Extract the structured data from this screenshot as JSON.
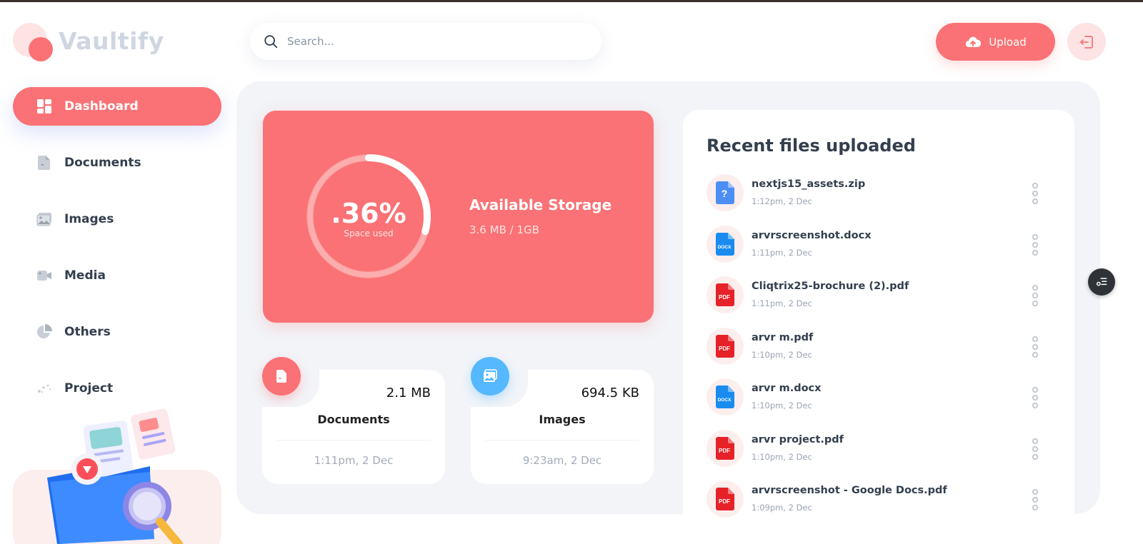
{
  "app": {
    "name": "Vaultify"
  },
  "colors": {
    "brand": "#fa7275",
    "brand_light": "#fde3e3",
    "images_blue": "#56b8ff",
    "bg_panel": "#f2f4f8",
    "text": "#333f4e"
  },
  "search": {
    "placeholder": "Search..."
  },
  "header": {
    "upload_label": "Upload"
  },
  "sidebar": {
    "items": [
      {
        "label": "Dashboard",
        "icon": "dashboard-icon",
        "active": true
      },
      {
        "label": "Documents",
        "icon": "document-icon",
        "active": false
      },
      {
        "label": "Images",
        "icon": "images-icon",
        "active": false
      },
      {
        "label": "Media",
        "icon": "video-icon",
        "active": false
      },
      {
        "label": "Others",
        "icon": "pie-chart-icon",
        "active": false
      },
      {
        "label": "Project",
        "icon": "project-icon",
        "active": false
      }
    ]
  },
  "storage": {
    "percent_label": ".36%",
    "percent_sub": "Space used",
    "used_fraction": 0.0036,
    "title": "Available Storage",
    "value": "3.6 MB / 1GB"
  },
  "summary": [
    {
      "size": "2.1 MB",
      "label": "Documents",
      "date": "1:11pm, 2 Dec",
      "icon": "document-icon"
    },
    {
      "size": "694.5 KB",
      "label": "Images",
      "date": "9:23am, 2 Dec",
      "icon": "images-icon"
    }
  ],
  "recent": {
    "title": "Recent files uploaded",
    "files": [
      {
        "name": "nextjs15_assets.zip",
        "date": "1:12pm, 2 Dec",
        "type": "unknown",
        "type_label": "?"
      },
      {
        "name": "arvrscreenshot.docx",
        "date": "1:11pm, 2 Dec",
        "type": "docx",
        "type_label": "DOCX"
      },
      {
        "name": "Cliqtrix25-brochure (2).pdf",
        "date": "1:11pm, 2 Dec",
        "type": "pdf",
        "type_label": "PDF"
      },
      {
        "name": "arvr m.pdf",
        "date": "1:10pm, 2 Dec",
        "type": "pdf",
        "type_label": "PDF"
      },
      {
        "name": "arvr m.docx",
        "date": "1:10pm, 2 Dec",
        "type": "docx",
        "type_label": "DOCX"
      },
      {
        "name": "arvr project.pdf",
        "date": "1:10pm, 2 Dec",
        "type": "pdf",
        "type_label": "PDF"
      },
      {
        "name": "arvrscreenshot - Google Docs.pdf",
        "date": "1:09pm, 2 Dec",
        "type": "pdf",
        "type_label": "PDF"
      }
    ]
  }
}
